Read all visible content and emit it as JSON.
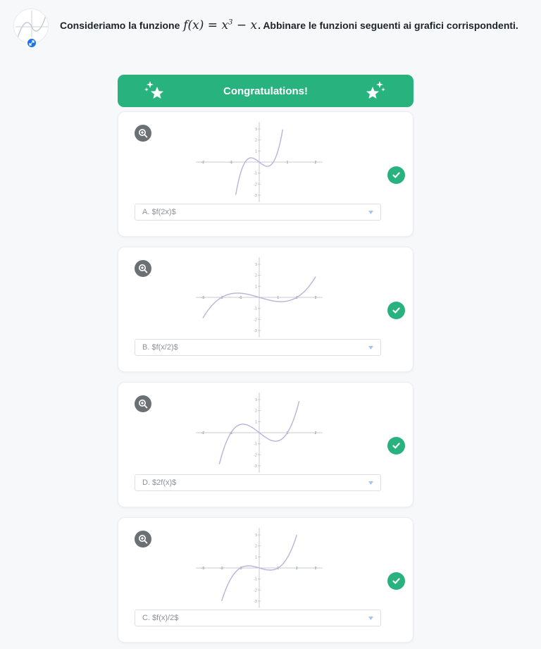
{
  "question": {
    "prefix": "Consideriamo la funzione",
    "math_lhs": "f(x) = x",
    "math_exp": "3",
    "math_rhs": " − x",
    "suffix": ". Abbinare le funzioni seguenti ai grafici corrispondenti."
  },
  "banner": {
    "title": "Congratulations!"
  },
  "colors": {
    "accent_green": "#27b27e",
    "curve": "#b9b3d9",
    "badge_blue": "#1a73e8"
  },
  "cards": [
    {
      "selected": "A. $f(2x)$",
      "function": "f(2x)",
      "x_ticks": [
        "-2",
        "-1",
        "1",
        "2"
      ],
      "y_ticks": [
        "3",
        "2",
        "1",
        "-1",
        "-2",
        "-3"
      ],
      "xlim": [
        -2,
        2
      ],
      "ylim": [
        -3,
        3
      ],
      "correct": true
    },
    {
      "selected": "B. $f(x/2)$",
      "function": "f(x/2)",
      "x_ticks": [
        "-3",
        "-2",
        "-1",
        "1",
        "2",
        "3"
      ],
      "y_ticks": [
        "3",
        "2",
        "1",
        "-1",
        "-2",
        "-3"
      ],
      "xlim": [
        -3,
        3
      ],
      "ylim": [
        -3,
        3
      ],
      "correct": true
    },
    {
      "selected": "D. $2f(x)$",
      "function": "2f(x)",
      "x_ticks": [
        "-2",
        "-1",
        "1",
        "2"
      ],
      "y_ticks": [
        "3",
        "2",
        "1",
        "-1",
        "-2",
        "-3"
      ],
      "xlim": [
        -2,
        2
      ],
      "ylim": [
        -3,
        3
      ],
      "correct": true
    },
    {
      "selected": "C. $f(x)/2$",
      "function": "f(x)/2",
      "x_ticks": [
        "-3",
        "-2",
        "-1",
        "1",
        "2",
        "3"
      ],
      "y_ticks": [
        "3",
        "2",
        "1",
        "-1",
        "-2",
        "-3"
      ],
      "xlim": [
        -3,
        3
      ],
      "ylim": [
        -3,
        3
      ],
      "correct": true
    }
  ]
}
